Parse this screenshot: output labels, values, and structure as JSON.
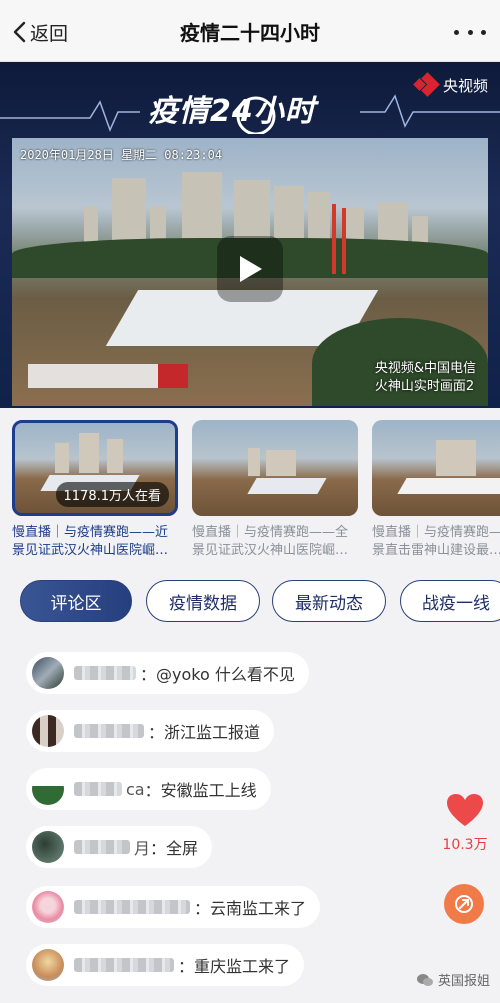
{
  "nav": {
    "back_label": "返回",
    "title": "疫情二十四小时"
  },
  "player": {
    "show_title": "疫情24小时",
    "broadcaster": "央视频",
    "timestamp": "2020年01月28日 星期二 08:23:04",
    "caption_line1": "央视频&中国电信",
    "caption_line2": "火神山实时画面2"
  },
  "thumbnails": [
    {
      "caption": "慢直播｜与疫情赛跑——近景见证武汉火神山医院崛…",
      "viewers": "1178.1万人在看",
      "active": true
    },
    {
      "caption": "慢直播｜与疫情赛跑——全景见证武汉火神山医院崛…",
      "active": false
    },
    {
      "caption": "慢直播｜与疫情赛跑——近景直击雷神山建设最…",
      "active": false
    }
  ],
  "tabs": [
    {
      "label": "评论区",
      "active": true
    },
    {
      "label": "疫情数据",
      "active": false
    },
    {
      "label": "最新动态",
      "active": false
    },
    {
      "label": "战疫一线",
      "active": false
    }
  ],
  "comments": [
    {
      "name_visible": "",
      "text": "：@yoko 什么看不见"
    },
    {
      "name_visible": "",
      "text": "：浙江监工报道"
    },
    {
      "name_visible": "ca",
      "text": "：安徽监工上线"
    },
    {
      "name_visible": "月",
      "text": "：全屏"
    },
    {
      "name_visible": "",
      "text": "：云南监工来了"
    },
    {
      "name_visible": "",
      "text": "：重庆监工来了"
    }
  ],
  "like": {
    "count": "10.3万"
  },
  "watermark": "英国报姐",
  "colors": {
    "accent": "#263f7e",
    "like": "#e64040",
    "share": "#f07a48"
  }
}
